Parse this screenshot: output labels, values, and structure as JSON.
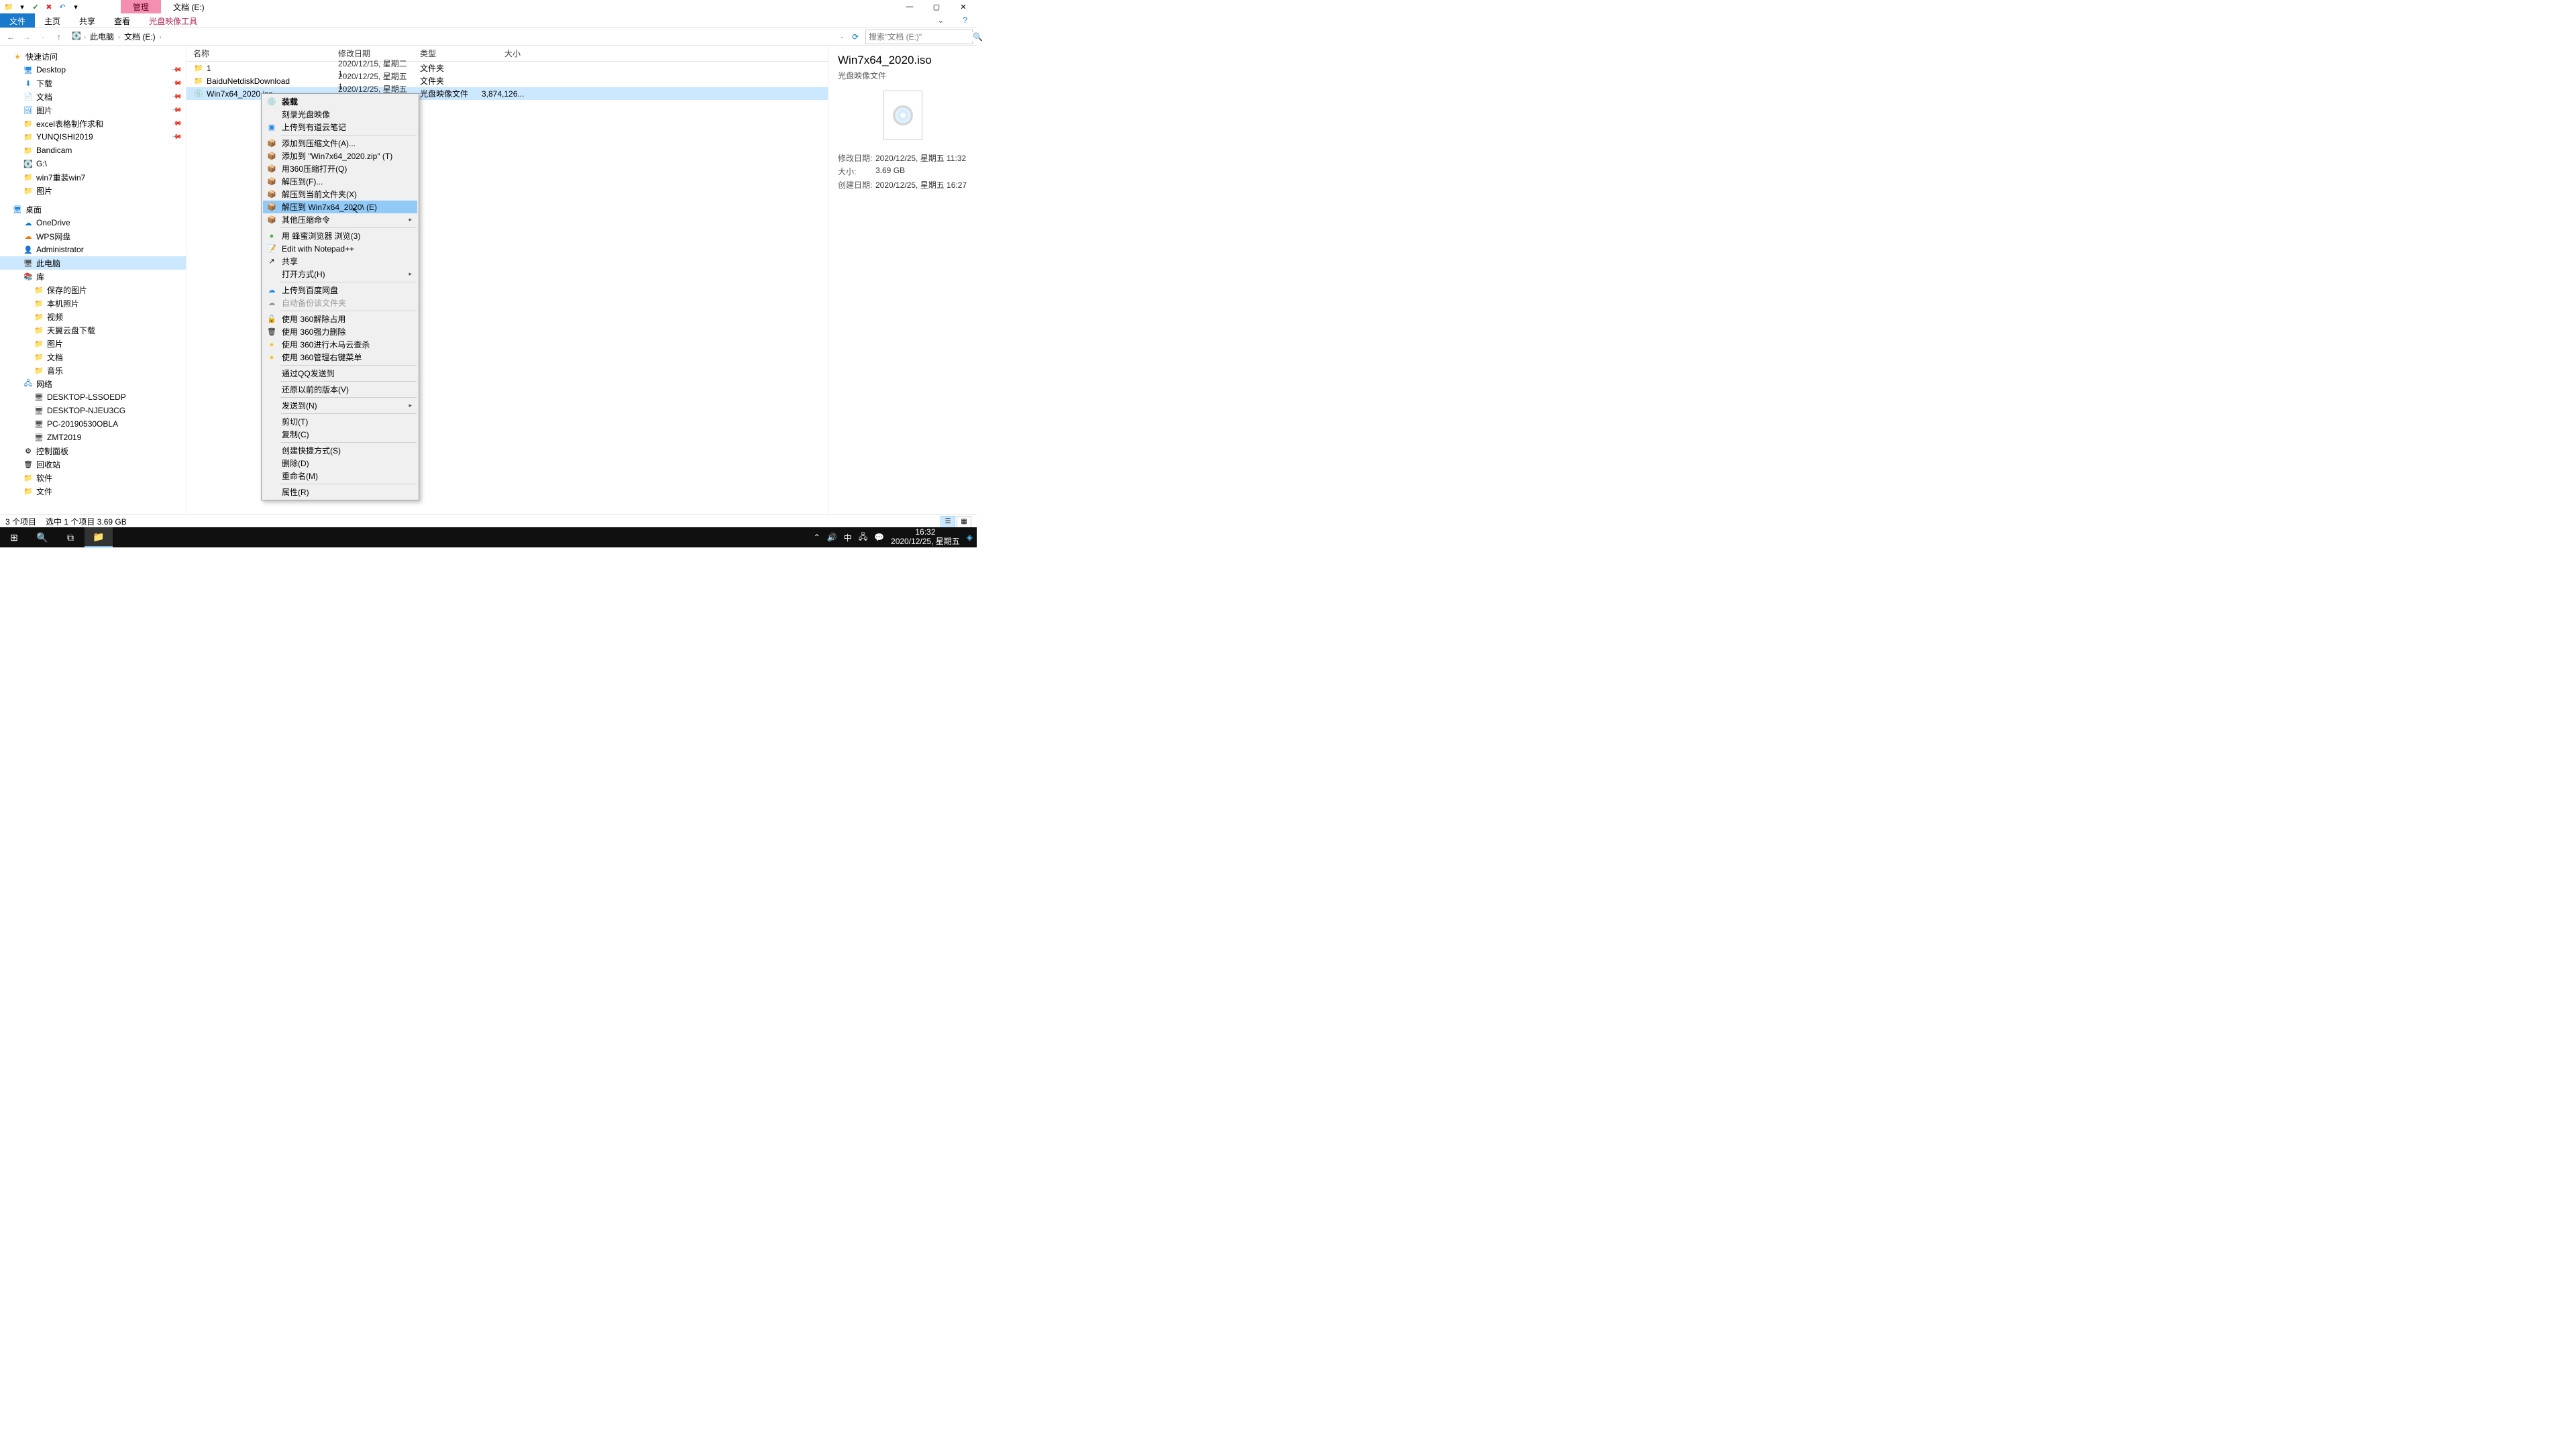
{
  "title_tabs": {
    "manage": "管理",
    "location": "文档 (E:)"
  },
  "ribbon": {
    "file": "文件",
    "home": "主页",
    "share": "共享",
    "view": "查看",
    "disc_tools": "光盘映像工具"
  },
  "win": {
    "min": "—",
    "max": "▢",
    "close": "✕",
    "help": "?"
  },
  "breadcrumb": {
    "pc": "此电脑",
    "drive": "文档 (E:)"
  },
  "search": {
    "placeholder": "搜索\"文档 (E:)\""
  },
  "nav": {
    "quick": "快速访问",
    "desktop": "Desktop",
    "downloads": "下载",
    "documents": "文档",
    "pictures": "图片",
    "excel": "excel表格制作求和",
    "yunqishi": "YUNQISHI2019",
    "bandicam": "Bandicam",
    "gdrive": "G:\\",
    "win7reinstall": "win7重装win7",
    "pictures2": "图片",
    "desk": "桌面",
    "onedrive": "OneDrive",
    "wps": "WPS网盘",
    "admin": "Administrator",
    "thispc": "此电脑",
    "lib": "库",
    "saved_pics": "保存的图片",
    "local_pics": "本机照片",
    "videos": "视频",
    "tianyi": "天翼云盘下载",
    "pics_lib": "图片",
    "docs_lib": "文档",
    "music": "音乐",
    "network": "网络",
    "n1": "DESKTOP-LSSOEDP",
    "n2": "DESKTOP-NJEU3CG",
    "n3": "PC-20190530OBLA",
    "n4": "ZMT2019",
    "control": "控制面板",
    "recycle": "回收站",
    "software": "软件",
    "files": "文件"
  },
  "cols": {
    "name": "名称",
    "date": "修改日期",
    "type": "类型",
    "size": "大小"
  },
  "rows": [
    {
      "name": "1",
      "date": "2020/12/15, 星期二 1...",
      "type": "文件夹",
      "size": "",
      "icon": "folder"
    },
    {
      "name": "BaiduNetdiskDownload",
      "date": "2020/12/25, 星期五 1...",
      "type": "文件夹",
      "size": "",
      "icon": "folder"
    },
    {
      "name": "Win7x64_2020.iso",
      "date": "2020/12/25, 星期五 1...",
      "type": "光盘映像文件",
      "size": "3,874,126...",
      "icon": "iso"
    }
  ],
  "preview": {
    "title": "Win7x64_2020.iso",
    "sub": "光盘映像文件",
    "mod_l": "修改日期:",
    "mod_v": "2020/12/25, 星期五 11:32",
    "size_l": "大小:",
    "size_v": "3.69 GB",
    "create_l": "创建日期:",
    "create_v": "2020/12/25, 星期五 16:27"
  },
  "status": {
    "count": "3 个项目",
    "sel": "选中 1 个项目  3.69 GB"
  },
  "ctx": {
    "mount": "装载",
    "burn": "刻录光盘映像",
    "youdao": "上传到有道云笔记",
    "addarchive": "添加到压缩文件(A)...",
    "addzip": "添加到 \"Win7x64_2020.zip\" (T)",
    "open360": "用360压缩打开(Q)",
    "extractto": "解压到(F)...",
    "extracthere": "解压到当前文件夹(X)",
    "extractname": "解压到 Win7x64_2020\\ (E)",
    "othercomp": "其他压缩命令",
    "bee": "用 蜂蜜浏览器 浏览(3)",
    "notepad": "Edit with Notepad++",
    "share": "共享",
    "openwith": "打开方式(H)",
    "baidu": "上传到百度网盘",
    "autobackup": "自动备份该文件夹",
    "unlock360": "使用 360解除占用",
    "force360": "使用 360强力删除",
    "trojan360": "使用 360进行木马云查杀",
    "menu360": "使用 360管理右键菜单",
    "qqsend": "通过QQ发送到",
    "restore": "还原以前的版本(V)",
    "sendto": "发送到(N)",
    "cut": "剪切(T)",
    "copy": "复制(C)",
    "shortcut": "创建快捷方式(S)",
    "delete": "删除(D)",
    "rename": "重命名(M)",
    "props": "属性(R)"
  },
  "taskbar": {
    "time": "16:32",
    "date": "2020/12/25, 星期五",
    "ime": "中"
  }
}
